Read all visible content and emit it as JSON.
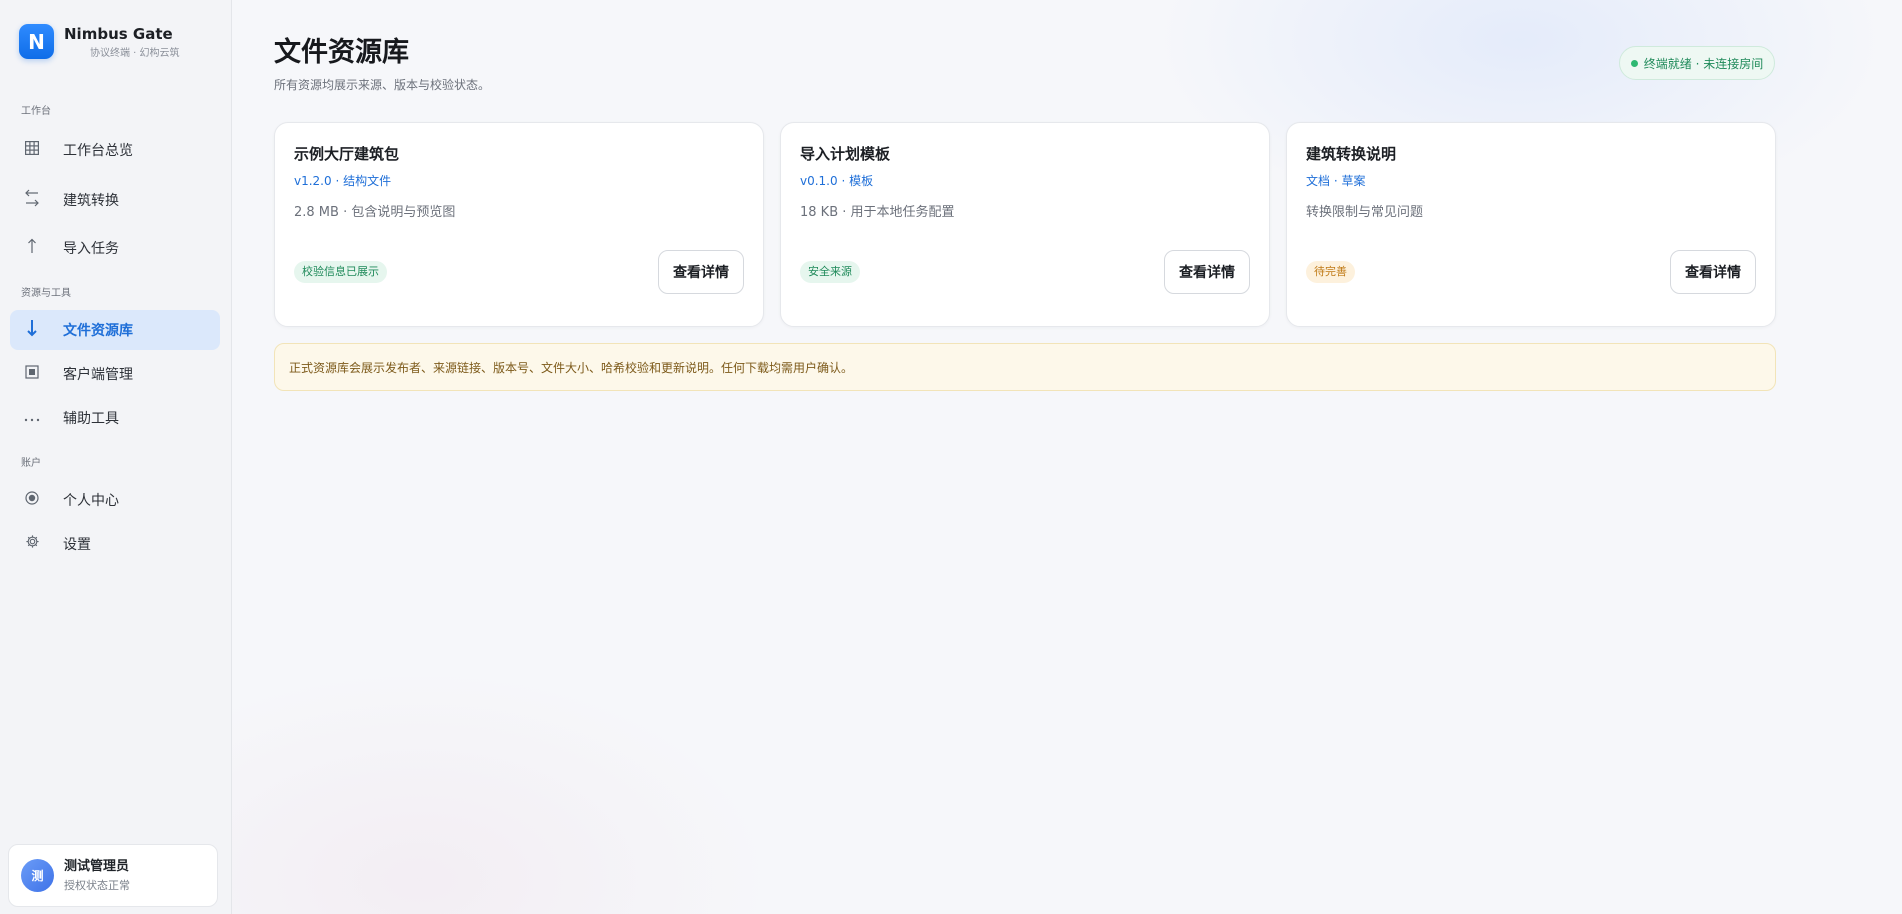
{
  "brand": {
    "logo_letter": "N",
    "name": "Nimbus Gate",
    "subtitle": "协议终端 · 幻构云筑"
  },
  "sidebar": {
    "sections": [
      {
        "label": "工作台"
      },
      {
        "label": "资源与工具"
      },
      {
        "label": "账户"
      }
    ],
    "items": [
      {
        "label": "工作台总览",
        "icon": "grid-icon"
      },
      {
        "label": "建筑转换",
        "icon": "swap-arrows-icon"
      },
      {
        "label": "导入任务",
        "icon": "upload-arrow-icon"
      },
      {
        "label": "文件资源库",
        "icon": "download-arrow-icon",
        "active": true
      },
      {
        "label": "客户端管理",
        "icon": "client-box-icon"
      },
      {
        "label": "辅助工具",
        "icon": "more-dots-icon"
      },
      {
        "label": "个人中心",
        "icon": "profile-dot-icon"
      },
      {
        "label": "设置",
        "icon": "gear-icon"
      }
    ]
  },
  "user": {
    "avatar_text": "测",
    "name": "测试管理员",
    "status": "授权状态正常"
  },
  "header": {
    "title": "文件资源库",
    "subtitle": "所有资源均展示来源、版本与校验状态。",
    "status": "终端就绪 · 未连接房间",
    "status_color": "#2eb872"
  },
  "cards": [
    {
      "title": "示例大厅建筑包",
      "meta": "v1.2.0 · 结构文件",
      "desc": "2.8 MB · 包含说明与预览图",
      "tag": "校验信息已展示",
      "tag_color": "green",
      "button": "查看详情"
    },
    {
      "title": "导入计划模板",
      "meta": "v0.1.0 · 模板",
      "desc": "18 KB · 用于本地任务配置",
      "tag": "安全来源",
      "tag_color": "green",
      "button": "查看详情"
    },
    {
      "title": "建筑转换说明",
      "meta": "文档 · 草案",
      "desc": "转换限制与常见问题",
      "tag": "待完善",
      "tag_color": "orange",
      "button": "查看详情"
    }
  ],
  "notice": {
    "text": "正式资源库会展示发布者、来源链接、版本号、文件大小、哈希校验和更新说明。任何下载均需用户确认。"
  },
  "colors": {
    "accent": "#1f6fd8",
    "brand_gradient_start": "#2f8bff",
    "success": "#1f8a5a",
    "warning": "#c07a16"
  }
}
